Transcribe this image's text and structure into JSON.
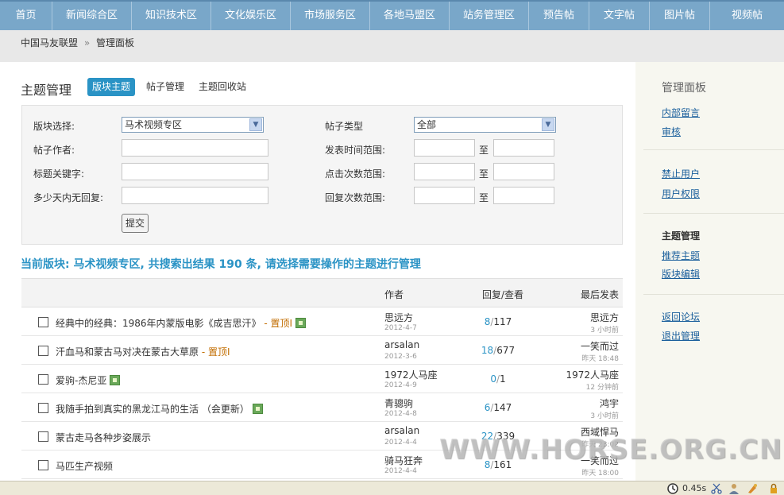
{
  "nav": {
    "items": [
      "首页",
      "新闻综合区",
      "知识技术区",
      "文化娱乐区",
      "市场服务区",
      "各地马盟区",
      "站务管理区",
      "预告帖",
      "文字帖",
      "图片帖",
      "视频帖"
    ]
  },
  "breadcrumb": {
    "home": "中国马友联盟",
    "sep": "»",
    "current": "管理面板"
  },
  "main": {
    "title": "主题管理",
    "tabs": [
      "版块主题",
      "帖子管理",
      "主题回收站"
    ]
  },
  "search": {
    "forum_label": "版块选择:",
    "forum_value": "马术视频专区",
    "type_label": "帖子类型",
    "type_value": "全部",
    "author_label": "帖子作者:",
    "time_label": "发表时间范围:",
    "keyword_label": "标题关键字:",
    "clicks_label": "点击次数范围:",
    "noreply_label": "多少天内无回复:",
    "replies_label": "回复次数范围:",
    "to": "至",
    "submit": "提交"
  },
  "result": {
    "text": "当前版块: 马术视频专区, 共搜索出结果  190 条, 请选择需要操作的主题进行管理"
  },
  "table": {
    "headers": {
      "author": "作者",
      "stats": "回复/查看",
      "last": "最后发表"
    },
    "rows": [
      {
        "title": "经典中的经典：1986年内蒙版电影《成吉思汗》",
        "sticky": " - 置顶I",
        "img": true,
        "author": "思远方",
        "date": "2012-4-7",
        "replies": "8",
        "views": "117",
        "last_user": "思远方",
        "last_time": "3 小时前"
      },
      {
        "title": "汗血马和蒙古马对决在蒙古大草原",
        "sticky": " - 置顶I",
        "img": false,
        "author": "arsalan",
        "date": "2012-3-6",
        "replies": "18",
        "views": "677",
        "last_user": "一笑而过",
        "last_time": "昨天 18:48"
      },
      {
        "title": "爱驹-杰尼亚",
        "sticky": "",
        "img": true,
        "author": "1972人马座",
        "date": "2012-4-9",
        "replies": "0",
        "views": "1",
        "last_user": "1972人马座",
        "last_time": "12 分钟前"
      },
      {
        "title": "我随手拍到真实的黑龙江马的生活 （会更新）",
        "sticky": "",
        "img": true,
        "author": "青骢驹",
        "date": "2012-4-8",
        "replies": "6",
        "views": "147",
        "last_user": "鸿宇",
        "last_time": "3 小时前"
      },
      {
        "title": "蒙古走马各种步姿展示",
        "sticky": "",
        "img": false,
        "author": "arsalan",
        "date": "2012-4-4",
        "replies": "22",
        "views": "339",
        "last_user": "西域悍马",
        "last_time": "昨天 23:02"
      },
      {
        "title": "马匹生产视频",
        "sticky": "",
        "img": false,
        "author": "骑马狂奔",
        "date": "2012-4-4",
        "replies": "8",
        "views": "161",
        "last_user": "一笑而过",
        "last_time": "昨天 18:00"
      }
    ]
  },
  "side": {
    "title": "管理面板",
    "link_message": "内部留言",
    "link_audit": "审核",
    "link_ban": "禁止用户",
    "link_perm": "用户权限",
    "section_topics": "主题管理",
    "link_recommend": "推荐主题",
    "link_forum_edit": "版块编辑",
    "link_back": "返回论坛",
    "link_logout": "退出管理"
  },
  "watermark": "WWW.HORSE.ORG.CN",
  "status": {
    "time": "0.45s"
  },
  "colors": {
    "nav_bg": "#79a7c9",
    "accent": "#2a93c5",
    "sticky": "#c26d00",
    "link": "#1a5f9c"
  }
}
